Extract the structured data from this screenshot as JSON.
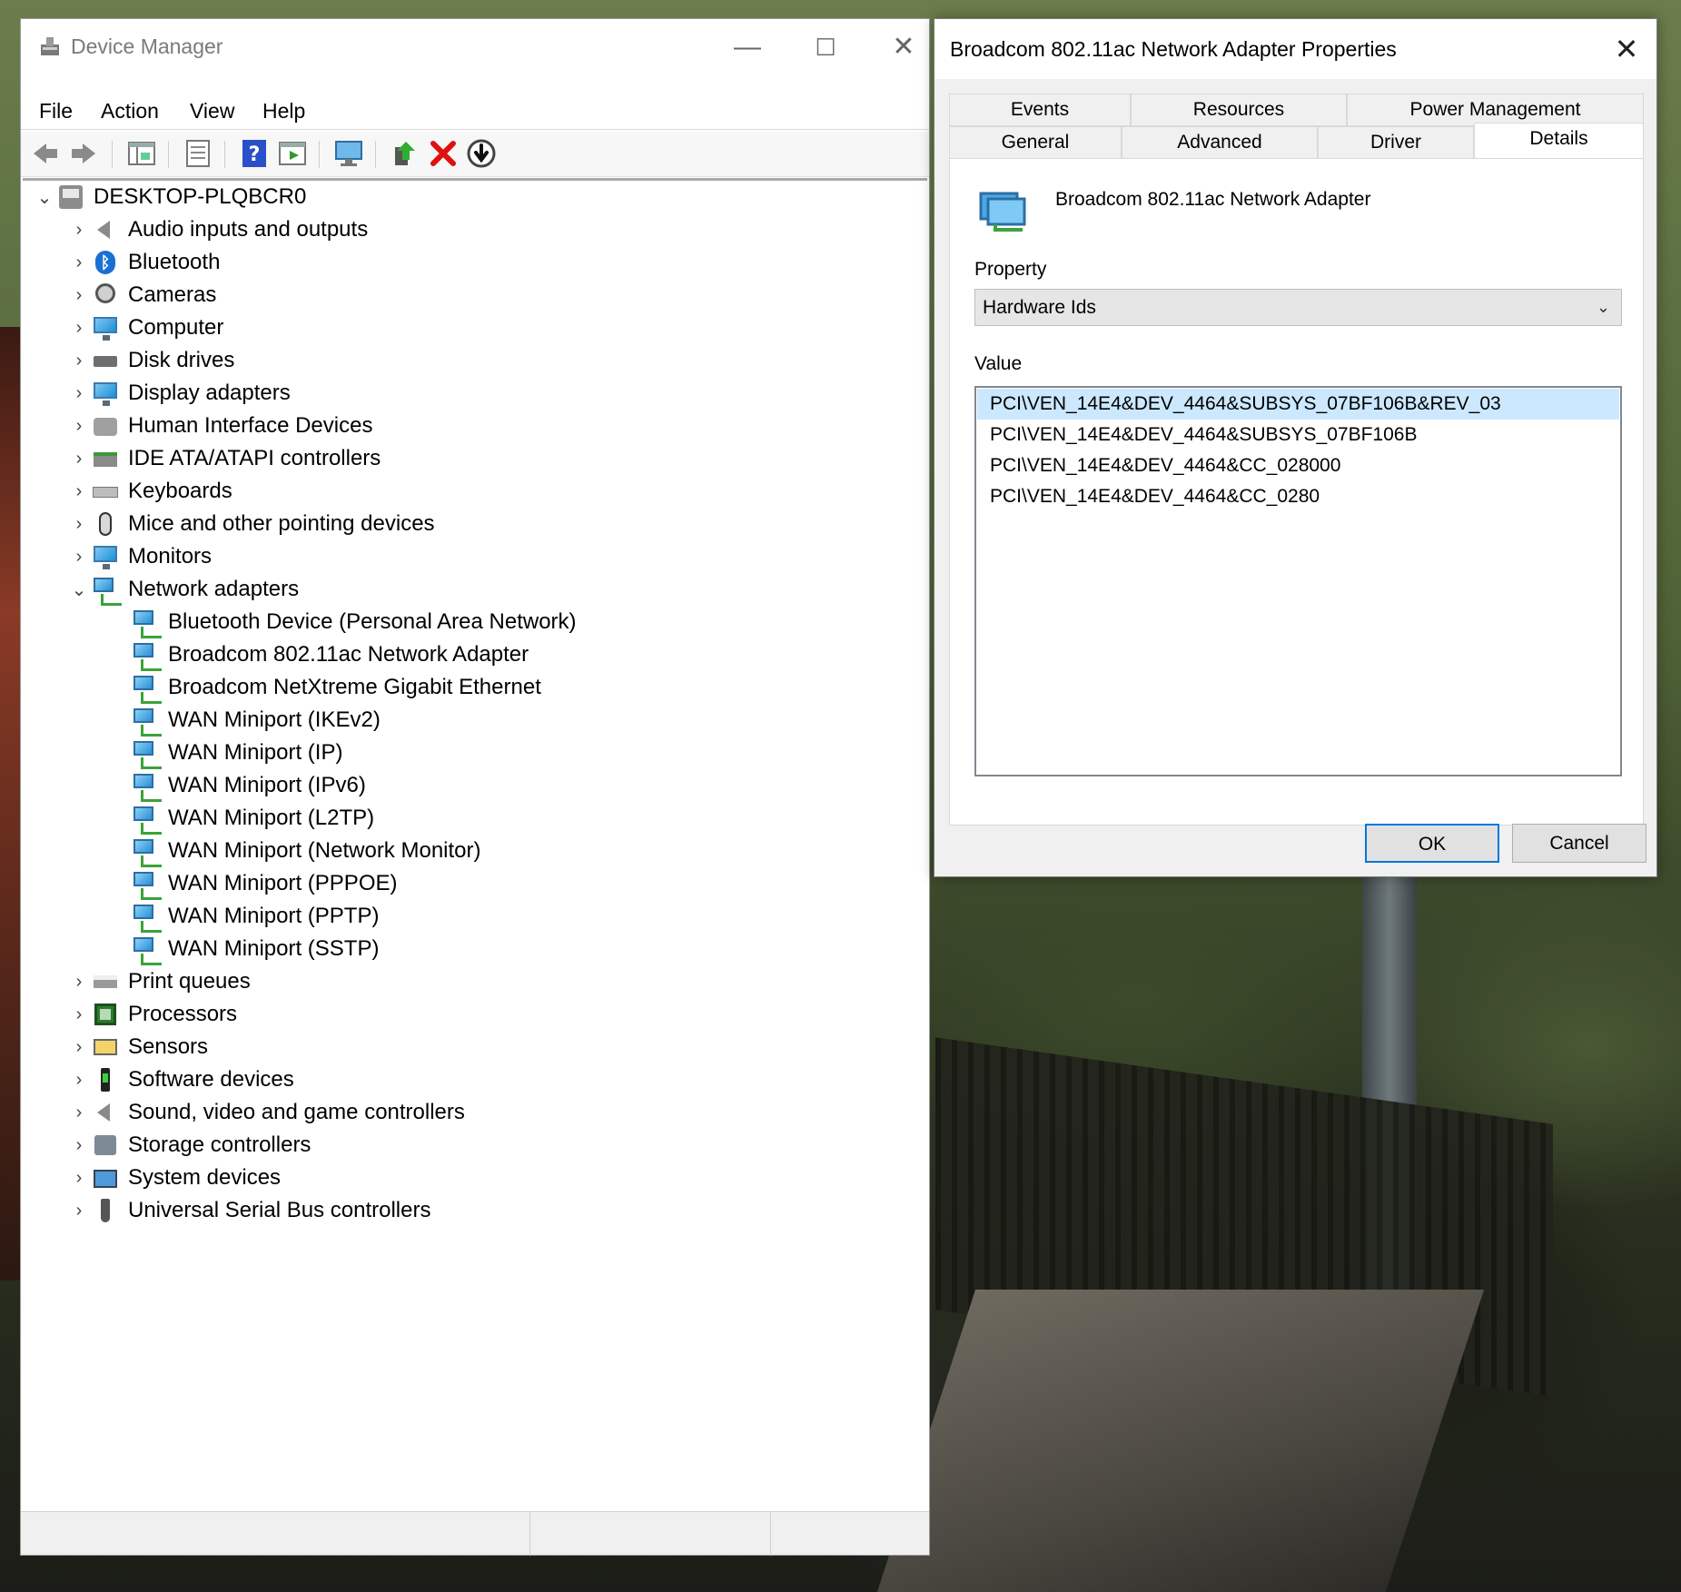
{
  "device_manager": {
    "title": "Device Manager",
    "window_controls": {
      "minimize": "—",
      "maximize": "☐",
      "close": "✕"
    },
    "menu": [
      "File",
      "Action",
      "View",
      "Help"
    ],
    "toolbar_icons": [
      "back-icon",
      "forward-icon",
      "properties-grid-icon",
      "list-view-icon",
      "help-icon",
      "run-icon",
      "scan-hardware-icon",
      "update-driver-icon",
      "uninstall-icon",
      "disable-icon"
    ],
    "tree": {
      "root": "DESKTOP-PLQBCR0",
      "categories": [
        "Audio inputs and outputs",
        "Bluetooth",
        "Cameras",
        "Computer",
        "Disk drives",
        "Display adapters",
        "Human Interface Devices",
        "IDE ATA/ATAPI controllers",
        "Keyboards",
        "Mice and other pointing devices",
        "Monitors",
        "Network adapters",
        "Print queues",
        "Processors",
        "Sensors",
        "Software devices",
        "Sound, video and game controllers",
        "Storage controllers",
        "System devices",
        "Universal Serial Bus controllers"
      ],
      "network_adapters": [
        "Bluetooth Device (Personal Area Network)",
        "Broadcom 802.11ac Network Adapter",
        "Broadcom NetXtreme Gigabit Ethernet",
        "WAN Miniport (IKEv2)",
        "WAN Miniport (IP)",
        "WAN Miniport (IPv6)",
        "WAN Miniport (L2TP)",
        "WAN Miniport (Network Monitor)",
        "WAN Miniport (PPPOE)",
        "WAN Miniport (PPTP)",
        "WAN Miniport (SSTP)"
      ]
    }
  },
  "properties_dialog": {
    "title": "Broadcom 802.11ac Network Adapter Properties",
    "close": "✕",
    "tabs_top": [
      "Events",
      "Resources",
      "Power Management"
    ],
    "tabs_bottom": [
      "General",
      "Advanced",
      "Driver",
      "Details"
    ],
    "active_tab": "Details",
    "device_name": "Broadcom 802.11ac Network Adapter",
    "property_label": "Property",
    "property_value": "Hardware Ids",
    "value_label": "Value",
    "values": [
      "PCI\\VEN_14E4&DEV_4464&SUBSYS_07BF106B&REV_03",
      "PCI\\VEN_14E4&DEV_4464&SUBSYS_07BF106B",
      "PCI\\VEN_14E4&DEV_4464&CC_028000",
      "PCI\\VEN_14E4&DEV_4464&CC_0280"
    ],
    "selected_value_index": 0,
    "ok": "OK",
    "cancel": "Cancel"
  },
  "colors": {
    "accent": "#0078d7",
    "selection": "#cce8ff"
  }
}
